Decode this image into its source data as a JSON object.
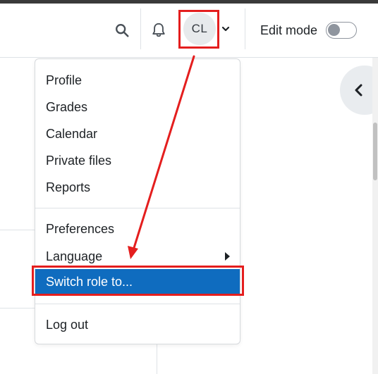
{
  "navbar": {
    "search_icon": "search-icon",
    "notification_icon": "bell-icon",
    "avatar_initials": "CL",
    "edit_mode_label": "Edit mode",
    "edit_mode_on": false
  },
  "user_menu": {
    "groups": [
      [
        "Profile",
        "Grades",
        "Calendar",
        "Private files",
        "Reports"
      ],
      [
        "Preferences",
        "Language",
        "Switch role to..."
      ],
      [
        "Log out"
      ]
    ],
    "items": {
      "profile": "Profile",
      "grades": "Grades",
      "calendar": "Calendar",
      "private_files": "Private files",
      "reports": "Reports",
      "preferences": "Preferences",
      "language": "Language",
      "switch_role": "Switch role to...",
      "logout": "Log out"
    },
    "active_item": "Switch role to..."
  },
  "annotation": {
    "highlight_color": "#e41e1e",
    "arrow_color": "#e41e1e"
  },
  "colors": {
    "active_bg": "#0f6cbf",
    "text": "#1d2125",
    "border": "#dee2e6"
  }
}
